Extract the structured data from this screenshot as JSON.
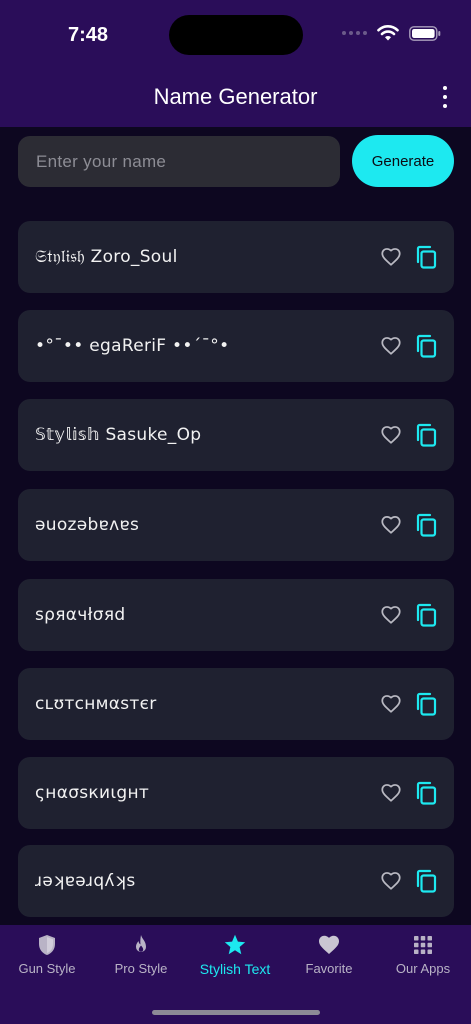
{
  "status_bar": {
    "time": "7:48"
  },
  "app_bar": {
    "title": "Name Generator"
  },
  "search": {
    "placeholder": "Enter your name",
    "value": ""
  },
  "generate_button": {
    "label": "Generate"
  },
  "results": [
    {
      "text": "𝔖𝔱𝔶𝔩𝔦𝔰𝔥 Zoro_Soul"
    },
    {
      "text": "•°¯•• egaReriF ••´¯°•"
    },
    {
      "text": "𝕊𝕥𝕪𝕝𝕚𝕤𝕙 Sasuke_Op"
    },
    {
      "text": "ǝuozǝbɐʌɐs"
    },
    {
      "text": "ѕρяαчłσяd"
    },
    {
      "text": "cʟʊтcнмαsтєr"
    },
    {
      "text": "ςнασѕкиιgнт"
    },
    {
      "text": "ɹǝʞɐǝɹqʎʞs"
    }
  ],
  "bottom_nav": {
    "items": [
      {
        "label": "Gun Style",
        "icon": "shield-icon"
      },
      {
        "label": "Pro Style",
        "icon": "flame-icon"
      },
      {
        "label": "Stylish Text",
        "icon": "star-icon",
        "active": true
      },
      {
        "label": "Favorite",
        "icon": "heart-icon"
      },
      {
        "label": "Our Apps",
        "icon": "grid-icon"
      }
    ]
  },
  "colors": {
    "header_bg": "#2a0d59",
    "body_bg": "#0d0720",
    "card_bg": "#1f2130",
    "accent": "#1de9f0"
  }
}
